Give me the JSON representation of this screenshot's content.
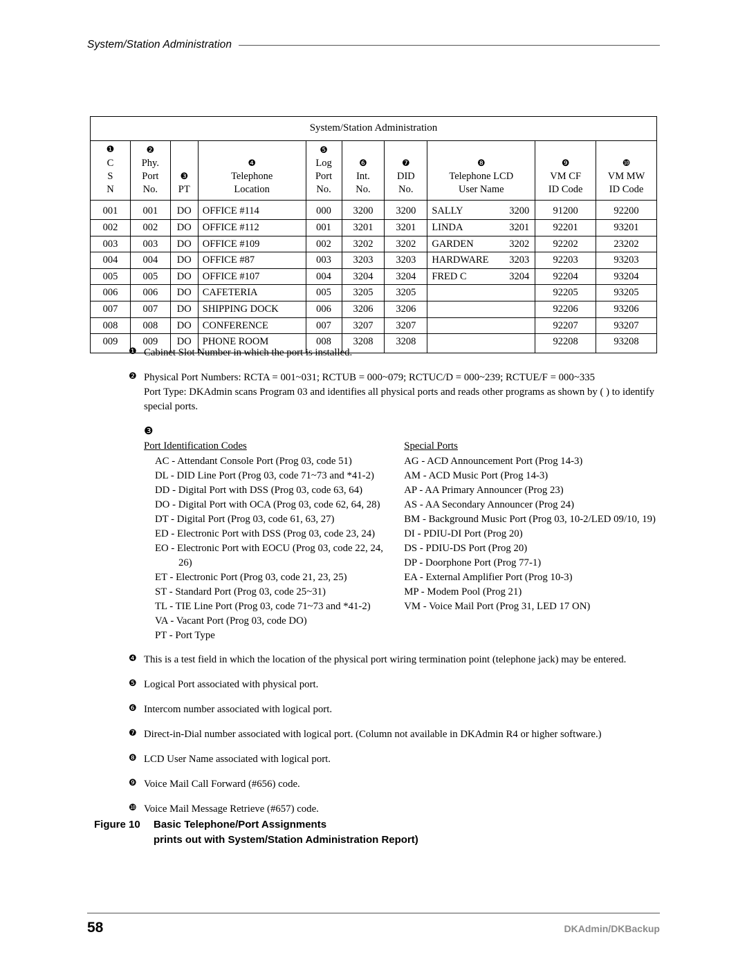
{
  "header": {
    "running_title": "System/Station Administration"
  },
  "table": {
    "title": "System/Station Administration",
    "columns": [
      {
        "marker": "❶",
        "lines": [
          "C",
          "S",
          "N"
        ]
      },
      {
        "marker": "❷",
        "lines": [
          "Phy.",
          "Port",
          "No."
        ]
      },
      {
        "marker": "❸",
        "lines": [
          "PT"
        ]
      },
      {
        "marker": "❹",
        "lines": [
          "Telephone",
          "Location"
        ]
      },
      {
        "marker": "❺",
        "lines": [
          "Log",
          "Port",
          "No."
        ]
      },
      {
        "marker": "❻",
        "lines": [
          "Int.",
          "No."
        ]
      },
      {
        "marker": "❼",
        "lines": [
          "DID",
          "No."
        ]
      },
      {
        "marker": "❽",
        "lines": [
          "Telephone LCD",
          "User Name"
        ]
      },
      {
        "marker": "❾",
        "lines": [
          "VM CF",
          "ID Code"
        ]
      },
      {
        "marker": "❿",
        "lines": [
          "VM MW",
          "ID Code"
        ]
      }
    ],
    "rows": [
      {
        "csn": "001",
        "phy": "001",
        "pt": "DO",
        "location": "OFFICE #114",
        "log": "000",
        "int": "3200",
        "did": "3200",
        "lcd_name": "SALLY",
        "lcd_num": "3200",
        "vm_cf": "91200",
        "vm_mw": "92200"
      },
      {
        "csn": "002",
        "phy": "002",
        "pt": "DO",
        "location": "OFFICE #112",
        "log": "001",
        "int": "3201",
        "did": "3201",
        "lcd_name": "LINDA",
        "lcd_num": "3201",
        "vm_cf": "92201",
        "vm_mw": "93201"
      },
      {
        "csn": "003",
        "phy": "003",
        "pt": "DO",
        "location": "OFFICE #109",
        "log": "002",
        "int": "3202",
        "did": "3202",
        "lcd_name": "GARDEN",
        "lcd_num": "3202",
        "vm_cf": "92202",
        "vm_mw": "23202"
      },
      {
        "csn": "004",
        "phy": "004",
        "pt": "DO",
        "location": "OFFICE #87",
        "log": "003",
        "int": "3203",
        "did": "3203",
        "lcd_name": "HARDWARE",
        "lcd_num": "3203",
        "vm_cf": "92203",
        "vm_mw": "93203"
      },
      {
        "csn": "005",
        "phy": "005",
        "pt": "DO",
        "location": "OFFICE #107",
        "log": "004",
        "int": "3204",
        "did": "3204",
        "lcd_name": "FRED C",
        "lcd_num": "3204",
        "vm_cf": "92204",
        "vm_mw": "93204"
      },
      {
        "csn": "006",
        "phy": "006",
        "pt": "DO",
        "location": "CAFETERIA",
        "log": "005",
        "int": "3205",
        "did": "3205",
        "lcd_name": "",
        "lcd_num": "",
        "vm_cf": "92205",
        "vm_mw": "93205"
      },
      {
        "csn": "007",
        "phy": "007",
        "pt": "DO",
        "location": "SHIPPING DOCK",
        "log": "006",
        "int": "3206",
        "did": "3206",
        "lcd_name": "",
        "lcd_num": "",
        "vm_cf": "92206",
        "vm_mw": "93206"
      },
      {
        "csn": "008",
        "phy": "008",
        "pt": "DO",
        "location": "CONFERENCE",
        "log": "007",
        "int": "3207",
        "did": "3207",
        "lcd_name": "",
        "lcd_num": "",
        "vm_cf": "92207",
        "vm_mw": "93207"
      },
      {
        "csn": "009",
        "phy": "009",
        "pt": "DO",
        "location": "PHONE ROOM",
        "log": "008",
        "int": "3208",
        "did": "3208",
        "lcd_name": "",
        "lcd_num": "",
        "vm_cf": "92208",
        "vm_mw": "93208"
      }
    ]
  },
  "notes": {
    "n1": {
      "marker": "❶",
      "text": "Cabinet Slot Number in which the port is installed."
    },
    "n2": {
      "marker": "❷",
      "line1": "Physical Port Numbers: RCTA = 001~031; RCTUB = 000~079; RCTUC/D = 000~239; RCTUE/F = 000~335",
      "line2": "Port Type: DKAdmin scans Program 03 and identifies all physical ports and reads other programs as shown by (   ) to identify special ports."
    },
    "n3": {
      "marker": "❸",
      "left_heading": "Port Identification Codes",
      "left_items": [
        "AC - Attendant Console Port (Prog 03, code 51)",
        "DL - DID Line Port (Prog 03, code 71~73 and *41-2)",
        "DD - Digital Port with DSS (Prog 03, code 63, 64)",
        "DO - Digital Port with OCA (Prog 03, code 62, 64, 28)",
        "DT - Digital Port (Prog 03, code 61, 63, 27)",
        "ED - Electronic Port with DSS (Prog 03, code 23, 24)"
      ],
      "left_item_eo": "EO - Electronic Port with EOCU (Prog 03, code 22, 24,",
      "left_item_eo_cont": "26)",
      "left_items_tail": [
        "ET - Electronic Port (Prog 03, code 21, 23, 25)",
        "ST - Standard Port (Prog 03, code 25~31)",
        "TL - TIE Line Port (Prog 03, code 71~73 and *41-2)",
        "VA - Vacant Port (Prog 03, code DO)",
        "PT - Port Type"
      ],
      "right_heading": "Special Ports",
      "right_items": [
        "AG - ACD Announcement Port (Prog 14-3)",
        "AM - ACD Music Port (Prog 14-3)",
        "AP - AA Primary Announcer (Prog 23)",
        "AS - AA Secondary Announcer (Prog 24)",
        "BM - Background Music Port (Prog 03, 10-2/LED 09/10, 19)",
        "DI - PDIU-DI Port (Prog 20)",
        "DS - PDIU-DS Port (Prog 20)",
        "DP - Doorphone Port (Prog 77-1)",
        "EA - External Amplifier Port (Prog 10-3)",
        "MP - Modem Pool (Prog 21)",
        "VM - Voice Mail Port (Prog 31, LED 17 ON)"
      ]
    },
    "n4": {
      "marker": "❹",
      "text": "This is a test field in which the location of the physical port wiring termination point (telephone jack) may be entered."
    },
    "n5": {
      "marker": "❺",
      "text": "Logical Port associated with physical port."
    },
    "n6": {
      "marker": "❻",
      "text": "Intercom number associated with logical port."
    },
    "n7": {
      "marker": "❼",
      "text": "Direct-in-Dial number associated with logical port. (Column not available in DKAdmin R4 or higher software.)"
    },
    "n8": {
      "marker": "❽",
      "text": "LCD User Name associated with logical port."
    },
    "n9": {
      "marker": "❾",
      "text": "Voice Mail Call Forward (#656) code."
    },
    "n10": {
      "marker": "❿",
      "text": "Voice Mail Message Retrieve (#657) code."
    }
  },
  "figure": {
    "label": "Figure 10",
    "title": "Basic Telephone/Port Assignments",
    "subtitle": "prints out with System/Station Administration Report)"
  },
  "footer": {
    "page_number": "58",
    "document_name": "DKAdmin/DKBackup"
  }
}
